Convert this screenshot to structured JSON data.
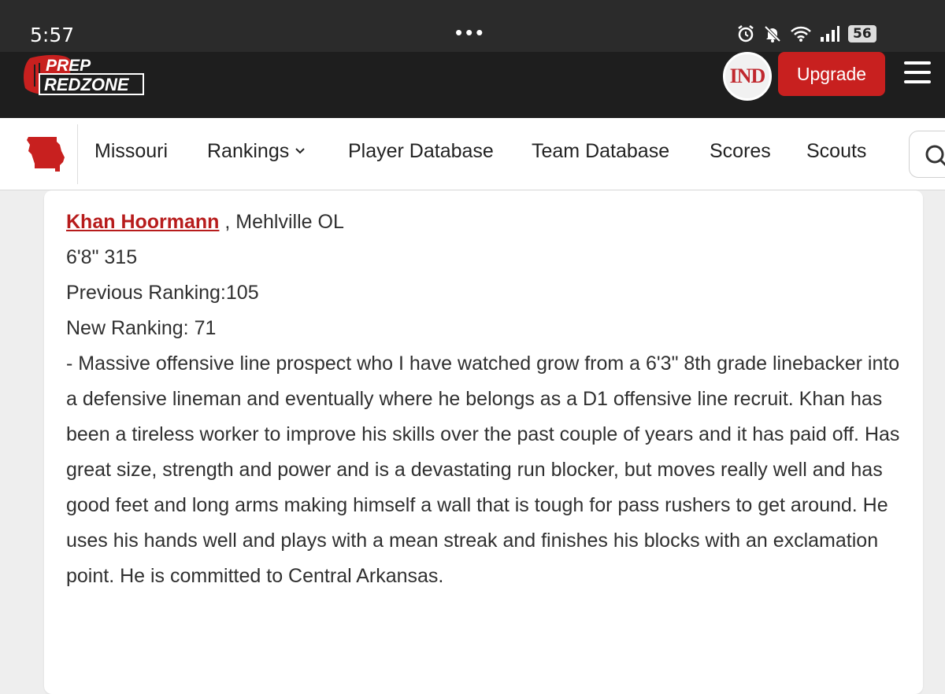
{
  "status_bar": {
    "time": "5:57",
    "dots": "•••",
    "battery": "56",
    "icons": [
      "alarm-icon",
      "mute-icon",
      "wifi-icon",
      "signal-icon",
      "battery-icon"
    ]
  },
  "app_bar": {
    "logo_line1": "PREP",
    "logo_line2": "REDZONE",
    "avatar_text": "IND",
    "upgrade_label": "Upgrade",
    "accent_color": "#c8201f"
  },
  "nav": {
    "items": [
      "Missouri",
      "Rankings",
      "Player Database",
      "Team Database",
      "Scores",
      "Scouts"
    ],
    "search_icon": "search-icon"
  },
  "article": {
    "player_name": "Khan Hoormann",
    "player_school": ", Mehlville OL",
    "height_weight": "6'8\" 315",
    "previous_ranking": "Previous Ranking:105",
    "new_ranking": "New Ranking: 71",
    "description": "- Massive offensive line prospect who I have watched grow from a 6'3\" 8th grade linebacker into a defensive lineman and eventually where he belongs as a D1 offensive line recruit. Khan has been a tireless worker to improve his skills over the past couple of years and it has paid off. Has great size, strength and power and is a devastating run blocker, but moves really well and has good feet and long arms making himself a wall that is tough for pass rushers to get around. He uses his hands well and plays with a mean streak and finishes his blocks with an exclamation point. He is committed to Central Arkansas."
  }
}
